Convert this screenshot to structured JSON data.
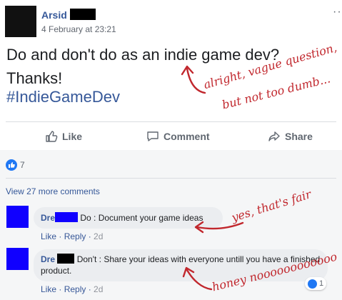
{
  "post": {
    "author": "Arsid",
    "timestamp": "4 February at 23:21",
    "text_line1": "Do and don't do as an indie game dev?",
    "text_line2": "Thanks!",
    "hashtag": "#IndieGameDev",
    "menu": "··"
  },
  "actions": {
    "like": "Like",
    "comment": "Comment",
    "share": "Share"
  },
  "reactions": {
    "count": "7",
    "icon": "thumbs-up-icon"
  },
  "view_more": "View 27 more comments",
  "comments": [
    {
      "name": "Dre",
      "text": "Do : Document your game ideas",
      "like": "Like",
      "reply": "Reply",
      "time": "2d"
    },
    {
      "name": "Dre",
      "text": "Don't : Share your ideas with everyone untill you have a finished product.",
      "like": "Like",
      "reply": "Reply",
      "time": "2d",
      "reaction_count": "1"
    }
  ],
  "annotations": {
    "a1_line1": "alright, vague question,",
    "a1_line2": "but not too dumb...",
    "a2": "yes, that's fair",
    "a3": "honey noooooooooooo"
  },
  "colors": {
    "facebook_blue": "#365899",
    "redaction_blue": "#1000ff",
    "annotation_red": "#c1272d",
    "reaction_blue": "#2078f4"
  }
}
